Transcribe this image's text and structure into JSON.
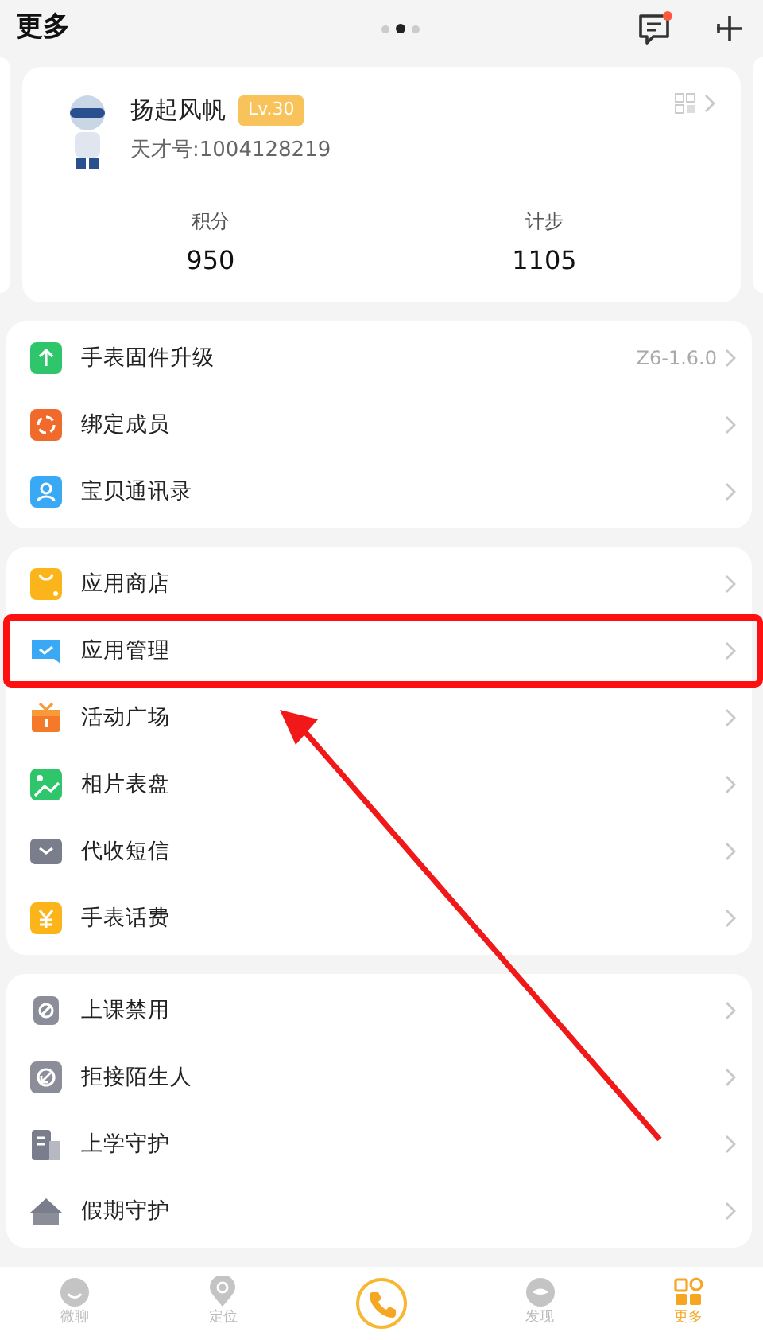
{
  "header": {
    "title": "更多",
    "page_dots": [
      {
        "selected": false
      },
      {
        "selected": true
      },
      {
        "selected": false
      }
    ],
    "message_unread": true
  },
  "profile": {
    "name": "扬起风帆",
    "level": "Lv.30",
    "id_text": "天才号:1004128219",
    "stats": [
      {
        "label": "积分",
        "value": "950"
      },
      {
        "label": "计步",
        "value": "1105"
      }
    ]
  },
  "groups": [
    {
      "items": [
        {
          "label": "手表固件升级",
          "value": "Z6-1.6.0",
          "highlighted": false
        },
        {
          "label": "绑定成员",
          "highlighted": false
        },
        {
          "label": "宝贝通讯录",
          "highlighted": false
        }
      ]
    },
    {
      "items": [
        {
          "label": "应用商店",
          "highlighted": false
        },
        {
          "label": "应用管理",
          "highlighted": true
        },
        {
          "label": "活动广场",
          "highlighted": false
        },
        {
          "label": "相片表盘",
          "highlighted": false
        },
        {
          "label": "代收短信",
          "highlighted": false
        },
        {
          "label": "手表话费",
          "highlighted": false
        }
      ]
    },
    {
      "items": [
        {
          "label": "上课禁用",
          "highlighted": false
        },
        {
          "label": "拒接陌生人",
          "highlighted": false
        },
        {
          "label": "上学守护",
          "highlighted": false
        },
        {
          "label": "假期守护",
          "highlighted": false
        }
      ]
    }
  ],
  "bottom_nav": [
    {
      "label": "微聊",
      "kind": "tab",
      "selected": false
    },
    {
      "label": "定位",
      "kind": "tab",
      "selected": false
    },
    {
      "kind": "call"
    },
    {
      "label": "发现",
      "kind": "tab",
      "selected": false
    },
    {
      "label": "更多",
      "kind": "tab",
      "selected": true
    }
  ]
}
